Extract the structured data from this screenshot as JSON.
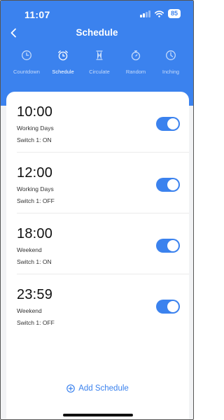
{
  "status": {
    "time": "11:07",
    "battery": "85"
  },
  "header": {
    "title": "Schedule"
  },
  "tabs": [
    {
      "label": "Countdown",
      "icon": "clock-icon",
      "active": false
    },
    {
      "label": "Schedule",
      "icon": "alarm-clock-icon",
      "active": true
    },
    {
      "label": "Circulate",
      "icon": "hourglass-icon",
      "active": false
    },
    {
      "label": "Random",
      "icon": "stopwatch-icon",
      "active": false
    },
    {
      "label": "Inching",
      "icon": "timer-icon",
      "active": false
    }
  ],
  "schedules": [
    {
      "time": "10:00",
      "days": "Working Days",
      "action": "Switch 1: ON",
      "enabled": true
    },
    {
      "time": "12:00",
      "days": "Working Days",
      "action": "Switch 1: OFF",
      "enabled": true
    },
    {
      "time": "18:00",
      "days": "Weekend",
      "action": "Switch 1: ON",
      "enabled": true
    },
    {
      "time": "23:59",
      "days": "Weekend",
      "action": "Switch 1: OFF",
      "enabled": true
    }
  ],
  "footer": {
    "add_label": "Add Schedule"
  },
  "colors": {
    "accent": "#3b82ee",
    "background": "#f2f3f5",
    "card": "#ffffff"
  }
}
